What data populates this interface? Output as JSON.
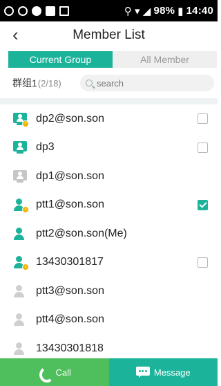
{
  "status_bar": {
    "icons": [
      "sync-icon",
      "sync-icon",
      "dot-icon",
      "square-icon",
      "image-icon",
      "location-icon",
      "wifi-icon",
      "signal-icon"
    ],
    "battery": "98%",
    "time": "14:40"
  },
  "header": {
    "back_glyph": "‹",
    "title": "Member List"
  },
  "tabs": [
    {
      "label": "Current Group",
      "active": true
    },
    {
      "label": "All Member",
      "active": false
    }
  ],
  "group": {
    "name": "群组1",
    "count": "(2/18)"
  },
  "search": {
    "placeholder": "search"
  },
  "members": [
    {
      "name": "dp2@son.son",
      "type": "dispatcher",
      "online": true,
      "badge": "clock-icon",
      "checkbox": "unchecked"
    },
    {
      "name": "dp3",
      "type": "dispatcher",
      "online": true,
      "badge": "",
      "checkbox": "unchecked"
    },
    {
      "name": "dp1@son.son",
      "type": "dispatcher",
      "online": false,
      "badge": "",
      "checkbox": ""
    },
    {
      "name": "ptt1@son.son",
      "type": "user",
      "online": true,
      "badge": "clock-icon",
      "checkbox": "checked"
    },
    {
      "name": "ptt2@son.son(Me)",
      "type": "user",
      "online": true,
      "badge": "",
      "checkbox": ""
    },
    {
      "name": "13430301817",
      "type": "user",
      "online": true,
      "badge": "clock-icon",
      "checkbox": "unchecked"
    },
    {
      "name": "ptt3@son.son",
      "type": "user",
      "online": false,
      "badge": "",
      "checkbox": ""
    },
    {
      "name": "ptt4@son.son",
      "type": "user",
      "online": false,
      "badge": "",
      "checkbox": ""
    },
    {
      "name": "13430301818",
      "type": "user",
      "online": false,
      "badge": "",
      "checkbox": ""
    }
  ],
  "bottom": {
    "call_label": "Call",
    "message_label": "Message"
  },
  "colors": {
    "accent": "#1cb39b",
    "call_green": "#4fbe5c",
    "badge_yellow": "#f0b400",
    "offline_gray": "#c6c6c6"
  }
}
